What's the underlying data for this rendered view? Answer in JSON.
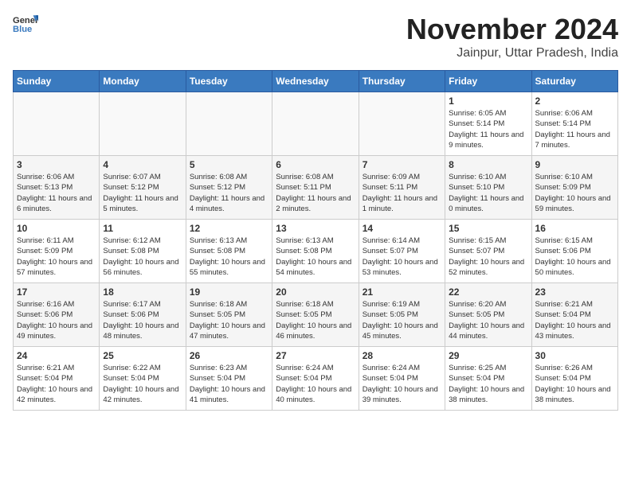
{
  "logo": {
    "text_general": "General",
    "text_blue": "Blue"
  },
  "title": {
    "month": "November 2024",
    "location": "Jainpur, Uttar Pradesh, India"
  },
  "headers": [
    "Sunday",
    "Monday",
    "Tuesday",
    "Wednesday",
    "Thursday",
    "Friday",
    "Saturday"
  ],
  "weeks": [
    [
      {
        "day": "",
        "info": ""
      },
      {
        "day": "",
        "info": ""
      },
      {
        "day": "",
        "info": ""
      },
      {
        "day": "",
        "info": ""
      },
      {
        "day": "",
        "info": ""
      },
      {
        "day": "1",
        "info": "Sunrise: 6:05 AM\nSunset: 5:14 PM\nDaylight: 11 hours and 9 minutes."
      },
      {
        "day": "2",
        "info": "Sunrise: 6:06 AM\nSunset: 5:14 PM\nDaylight: 11 hours and 7 minutes."
      }
    ],
    [
      {
        "day": "3",
        "info": "Sunrise: 6:06 AM\nSunset: 5:13 PM\nDaylight: 11 hours and 6 minutes."
      },
      {
        "day": "4",
        "info": "Sunrise: 6:07 AM\nSunset: 5:12 PM\nDaylight: 11 hours and 5 minutes."
      },
      {
        "day": "5",
        "info": "Sunrise: 6:08 AM\nSunset: 5:12 PM\nDaylight: 11 hours and 4 minutes."
      },
      {
        "day": "6",
        "info": "Sunrise: 6:08 AM\nSunset: 5:11 PM\nDaylight: 11 hours and 2 minutes."
      },
      {
        "day": "7",
        "info": "Sunrise: 6:09 AM\nSunset: 5:11 PM\nDaylight: 11 hours and 1 minute."
      },
      {
        "day": "8",
        "info": "Sunrise: 6:10 AM\nSunset: 5:10 PM\nDaylight: 11 hours and 0 minutes."
      },
      {
        "day": "9",
        "info": "Sunrise: 6:10 AM\nSunset: 5:09 PM\nDaylight: 10 hours and 59 minutes."
      }
    ],
    [
      {
        "day": "10",
        "info": "Sunrise: 6:11 AM\nSunset: 5:09 PM\nDaylight: 10 hours and 57 minutes."
      },
      {
        "day": "11",
        "info": "Sunrise: 6:12 AM\nSunset: 5:08 PM\nDaylight: 10 hours and 56 minutes."
      },
      {
        "day": "12",
        "info": "Sunrise: 6:13 AM\nSunset: 5:08 PM\nDaylight: 10 hours and 55 minutes."
      },
      {
        "day": "13",
        "info": "Sunrise: 6:13 AM\nSunset: 5:08 PM\nDaylight: 10 hours and 54 minutes."
      },
      {
        "day": "14",
        "info": "Sunrise: 6:14 AM\nSunset: 5:07 PM\nDaylight: 10 hours and 53 minutes."
      },
      {
        "day": "15",
        "info": "Sunrise: 6:15 AM\nSunset: 5:07 PM\nDaylight: 10 hours and 52 minutes."
      },
      {
        "day": "16",
        "info": "Sunrise: 6:15 AM\nSunset: 5:06 PM\nDaylight: 10 hours and 50 minutes."
      }
    ],
    [
      {
        "day": "17",
        "info": "Sunrise: 6:16 AM\nSunset: 5:06 PM\nDaylight: 10 hours and 49 minutes."
      },
      {
        "day": "18",
        "info": "Sunrise: 6:17 AM\nSunset: 5:06 PM\nDaylight: 10 hours and 48 minutes."
      },
      {
        "day": "19",
        "info": "Sunrise: 6:18 AM\nSunset: 5:05 PM\nDaylight: 10 hours and 47 minutes."
      },
      {
        "day": "20",
        "info": "Sunrise: 6:18 AM\nSunset: 5:05 PM\nDaylight: 10 hours and 46 minutes."
      },
      {
        "day": "21",
        "info": "Sunrise: 6:19 AM\nSunset: 5:05 PM\nDaylight: 10 hours and 45 minutes."
      },
      {
        "day": "22",
        "info": "Sunrise: 6:20 AM\nSunset: 5:05 PM\nDaylight: 10 hours and 44 minutes."
      },
      {
        "day": "23",
        "info": "Sunrise: 6:21 AM\nSunset: 5:04 PM\nDaylight: 10 hours and 43 minutes."
      }
    ],
    [
      {
        "day": "24",
        "info": "Sunrise: 6:21 AM\nSunset: 5:04 PM\nDaylight: 10 hours and 42 minutes."
      },
      {
        "day": "25",
        "info": "Sunrise: 6:22 AM\nSunset: 5:04 PM\nDaylight: 10 hours and 42 minutes."
      },
      {
        "day": "26",
        "info": "Sunrise: 6:23 AM\nSunset: 5:04 PM\nDaylight: 10 hours and 41 minutes."
      },
      {
        "day": "27",
        "info": "Sunrise: 6:24 AM\nSunset: 5:04 PM\nDaylight: 10 hours and 40 minutes."
      },
      {
        "day": "28",
        "info": "Sunrise: 6:24 AM\nSunset: 5:04 PM\nDaylight: 10 hours and 39 minutes."
      },
      {
        "day": "29",
        "info": "Sunrise: 6:25 AM\nSunset: 5:04 PM\nDaylight: 10 hours and 38 minutes."
      },
      {
        "day": "30",
        "info": "Sunrise: 6:26 AM\nSunset: 5:04 PM\nDaylight: 10 hours and 38 minutes."
      }
    ]
  ]
}
